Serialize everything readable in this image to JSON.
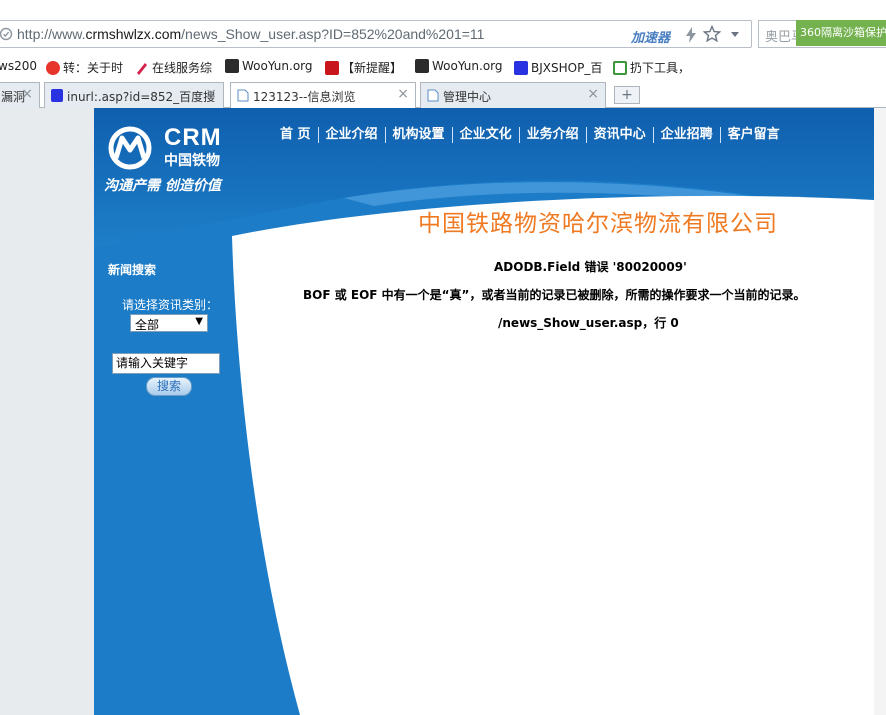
{
  "browser": {
    "url_prefix": "http://www.",
    "url_domain": "crmshwlzx.com",
    "url_path": "/news_Show_user.asp?ID=852%20and%201=11",
    "accelerator_label": "加速器",
    "search_placeholder": "奥巴马密友买豪宅",
    "sandbox_badge": "360隔离沙箱保护",
    "bookmarks": [
      {
        "label": "ws200",
        "icon": "page-icon"
      },
      {
        "label": "转：关于时",
        "icon": "sina-icon"
      },
      {
        "label": "在线服务综",
        "icon": "pen-icon"
      },
      {
        "label": "WooYun.org",
        "icon": "wooyun-icon"
      },
      {
        "label": "【新提醒】",
        "icon": "h-icon"
      },
      {
        "label": "WooYun.org",
        "icon": "wooyun-icon"
      },
      {
        "label": "BJXSHOP_百",
        "icon": "paw-icon"
      },
      {
        "label": "扔下工具，",
        "icon": "tool-icon"
      }
    ],
    "tabs": [
      {
        "label": "漏洞",
        "icon": "page-icon"
      },
      {
        "label": "inurl:.asp?id=852_百度搜",
        "icon": "paw-icon"
      },
      {
        "label": "123123--信息浏览",
        "icon": "page-icon"
      },
      {
        "label": "管理中心",
        "icon": "page-icon"
      }
    ],
    "new_tab_label": "+"
  },
  "site": {
    "logo_text": "CRM",
    "logo_cn": "中国铁物",
    "slogan": "沟通产需 创造价值",
    "nav": [
      "首 页",
      "企业介绍",
      "机构设置",
      "企业文化",
      "业务介绍",
      "资讯中心",
      "企业招聘",
      "客户留言"
    ],
    "company_title": "中国铁路物资哈尔滨物流有限公司",
    "sidebar": {
      "title": "新闻搜索",
      "category_label": "请选择资讯类别：",
      "category_value": "全部",
      "keyword_value": "请输入关键字",
      "search_button": "搜索"
    },
    "error": {
      "line1": "ADODB.Field  错误 '80020009'",
      "line2": "BOF 或 EOF 中有一个是“真”，或者当前的记录已被删除，所需的操作要求一个当前的记录。",
      "line3": "/news_Show_user.asp，行 0"
    }
  },
  "colors": {
    "site_blue": "#1e7fc9",
    "title_orange": "#f07a22",
    "badge_green": "#73b24f"
  }
}
